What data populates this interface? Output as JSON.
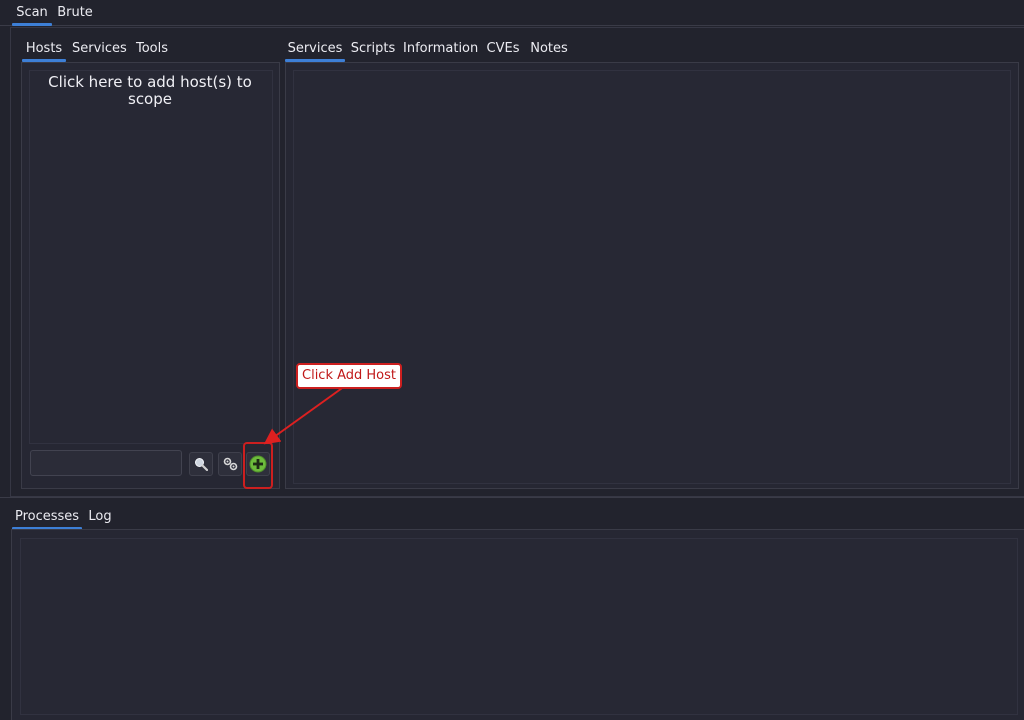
{
  "top_tabs": [
    "Scan",
    "Brute"
  ],
  "left_tabs": [
    "Hosts",
    "Services",
    "Tools"
  ],
  "right_tabs": [
    "Services",
    "Scripts",
    "Information",
    "CVEs",
    "Notes"
  ],
  "bottom_tabs": [
    "Processes",
    "Log"
  ],
  "hosts_placeholder": "Click here to add host(s) to scope",
  "filter_input_value": "",
  "toolbar": {
    "search_icon": "magnifier-icon",
    "settings_icon": "gears-icon",
    "add_host_icon": "plus-circle-icon",
    "add_host_color": "#6dbb3c"
  },
  "annotation": {
    "label": "Click Add Host",
    "color": "#cc1f1f"
  }
}
